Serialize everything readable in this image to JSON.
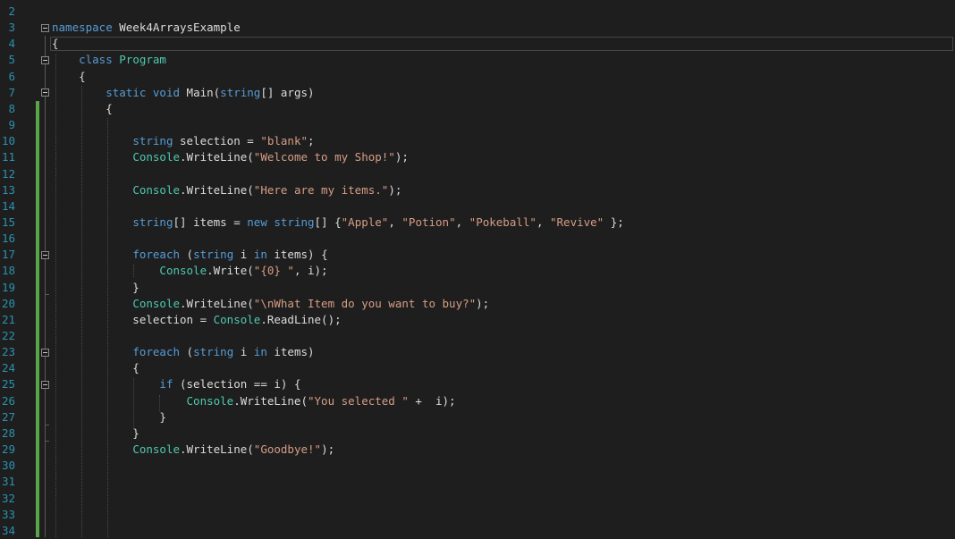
{
  "editor": {
    "colors": {
      "keyword": "#569cd6",
      "type": "#4ec9b0",
      "string": "#d69d85",
      "plain": "#dcdcdc",
      "line_number": "#2b91af",
      "change_bar": "#57a64a",
      "background": "#1e1e1e"
    },
    "lines": [
      {
        "num": "2",
        "tokens": []
      },
      {
        "num": "3",
        "tokens": [
          {
            "t": "namespace",
            "c": "kw"
          },
          {
            "t": " Week4ArraysExample",
            "c": "pl"
          }
        ]
      },
      {
        "num": "4",
        "tokens": [
          {
            "t": "{",
            "c": "pl"
          }
        ]
      },
      {
        "num": "5",
        "tokens": [
          {
            "t": "    ",
            "c": "pl"
          },
          {
            "t": "class",
            "c": "kw"
          },
          {
            "t": " ",
            "c": "pl"
          },
          {
            "t": "Program",
            "c": "ty"
          }
        ]
      },
      {
        "num": "6",
        "tokens": [
          {
            "t": "    {",
            "c": "pl"
          }
        ]
      },
      {
        "num": "7",
        "tokens": [
          {
            "t": "        ",
            "c": "pl"
          },
          {
            "t": "static",
            "c": "kw"
          },
          {
            "t": " ",
            "c": "pl"
          },
          {
            "t": "void",
            "c": "kw"
          },
          {
            "t": " Main(",
            "c": "pl"
          },
          {
            "t": "string",
            "c": "kw"
          },
          {
            "t": "[] args)",
            "c": "pl"
          }
        ]
      },
      {
        "num": "8",
        "tokens": [
          {
            "t": "        {",
            "c": "pl"
          }
        ]
      },
      {
        "num": "9",
        "tokens": []
      },
      {
        "num": "10",
        "tokens": [
          {
            "t": "            ",
            "c": "pl"
          },
          {
            "t": "string",
            "c": "kw"
          },
          {
            "t": " selection = ",
            "c": "pl"
          },
          {
            "t": "\"blank\"",
            "c": "st"
          },
          {
            "t": ";",
            "c": "pl"
          }
        ]
      },
      {
        "num": "11",
        "tokens": [
          {
            "t": "            ",
            "c": "pl"
          },
          {
            "t": "Console",
            "c": "ty"
          },
          {
            "t": ".WriteLine(",
            "c": "pl"
          },
          {
            "t": "\"Welcome to my Shop!\"",
            "c": "st"
          },
          {
            "t": ");",
            "c": "pl"
          }
        ]
      },
      {
        "num": "12",
        "tokens": []
      },
      {
        "num": "13",
        "tokens": [
          {
            "t": "            ",
            "c": "pl"
          },
          {
            "t": "Console",
            "c": "ty"
          },
          {
            "t": ".WriteLine(",
            "c": "pl"
          },
          {
            "t": "\"Here are my items.\"",
            "c": "st"
          },
          {
            "t": ");",
            "c": "pl"
          }
        ]
      },
      {
        "num": "14",
        "tokens": []
      },
      {
        "num": "15",
        "tokens": [
          {
            "t": "            ",
            "c": "pl"
          },
          {
            "t": "string",
            "c": "kw"
          },
          {
            "t": "[] items = ",
            "c": "pl"
          },
          {
            "t": "new",
            "c": "kw"
          },
          {
            "t": " ",
            "c": "pl"
          },
          {
            "t": "string",
            "c": "kw"
          },
          {
            "t": "[] {",
            "c": "pl"
          },
          {
            "t": "\"Apple\"",
            "c": "st"
          },
          {
            "t": ", ",
            "c": "pl"
          },
          {
            "t": "\"Potion\"",
            "c": "st"
          },
          {
            "t": ", ",
            "c": "pl"
          },
          {
            "t": "\"Pokeball\"",
            "c": "st"
          },
          {
            "t": ", ",
            "c": "pl"
          },
          {
            "t": "\"Revive\"",
            "c": "st"
          },
          {
            "t": " };",
            "c": "pl"
          }
        ]
      },
      {
        "num": "16",
        "tokens": []
      },
      {
        "num": "17",
        "tokens": [
          {
            "t": "            ",
            "c": "pl"
          },
          {
            "t": "foreach",
            "c": "kw"
          },
          {
            "t": " (",
            "c": "pl"
          },
          {
            "t": "string",
            "c": "kw"
          },
          {
            "t": " i ",
            "c": "pl"
          },
          {
            "t": "in",
            "c": "kw"
          },
          {
            "t": " items) {",
            "c": "pl"
          }
        ]
      },
      {
        "num": "18",
        "tokens": [
          {
            "t": "                ",
            "c": "pl"
          },
          {
            "t": "Console",
            "c": "ty"
          },
          {
            "t": ".Write(",
            "c": "pl"
          },
          {
            "t": "\"{0} \"",
            "c": "st"
          },
          {
            "t": ", i);",
            "c": "pl"
          }
        ]
      },
      {
        "num": "19",
        "tokens": [
          {
            "t": "            }",
            "c": "pl"
          }
        ]
      },
      {
        "num": "20",
        "tokens": [
          {
            "t": "            ",
            "c": "pl"
          },
          {
            "t": "Console",
            "c": "ty"
          },
          {
            "t": ".WriteLine(",
            "c": "pl"
          },
          {
            "t": "\"\\nWhat Item do you want to buy?\"",
            "c": "st"
          },
          {
            "t": ");",
            "c": "pl"
          }
        ]
      },
      {
        "num": "21",
        "tokens": [
          {
            "t": "            selection = ",
            "c": "pl"
          },
          {
            "t": "Console",
            "c": "ty"
          },
          {
            "t": ".ReadLine();",
            "c": "pl"
          }
        ]
      },
      {
        "num": "22",
        "tokens": []
      },
      {
        "num": "23",
        "tokens": [
          {
            "t": "            ",
            "c": "pl"
          },
          {
            "t": "foreach",
            "c": "kw"
          },
          {
            "t": " (",
            "c": "pl"
          },
          {
            "t": "string",
            "c": "kw"
          },
          {
            "t": " i ",
            "c": "pl"
          },
          {
            "t": "in",
            "c": "kw"
          },
          {
            "t": " items)",
            "c": "pl"
          }
        ]
      },
      {
        "num": "24",
        "tokens": [
          {
            "t": "            {",
            "c": "pl"
          }
        ]
      },
      {
        "num": "25",
        "tokens": [
          {
            "t": "                ",
            "c": "pl"
          },
          {
            "t": "if",
            "c": "kw"
          },
          {
            "t": " (selection == i) {",
            "c": "pl"
          }
        ]
      },
      {
        "num": "26",
        "tokens": [
          {
            "t": "                    ",
            "c": "pl"
          },
          {
            "t": "Console",
            "c": "ty"
          },
          {
            "t": ".WriteLine(",
            "c": "pl"
          },
          {
            "t": "\"You selected \"",
            "c": "st"
          },
          {
            "t": " +  i);",
            "c": "pl"
          }
        ]
      },
      {
        "num": "27",
        "tokens": [
          {
            "t": "                }",
            "c": "pl"
          }
        ]
      },
      {
        "num": "28",
        "tokens": [
          {
            "t": "            }",
            "c": "pl"
          }
        ]
      },
      {
        "num": "29",
        "tokens": [
          {
            "t": "            ",
            "c": "pl"
          },
          {
            "t": "Console",
            "c": "ty"
          },
          {
            "t": ".WriteLine(",
            "c": "pl"
          },
          {
            "t": "\"Goodbye!\"",
            "c": "st"
          },
          {
            "t": ");",
            "c": "pl"
          }
        ]
      },
      {
        "num": "30",
        "tokens": []
      },
      {
        "num": "31",
        "tokens": []
      },
      {
        "num": "32",
        "tokens": []
      },
      {
        "num": "33",
        "tokens": []
      },
      {
        "num": "34",
        "tokens": []
      }
    ]
  }
}
